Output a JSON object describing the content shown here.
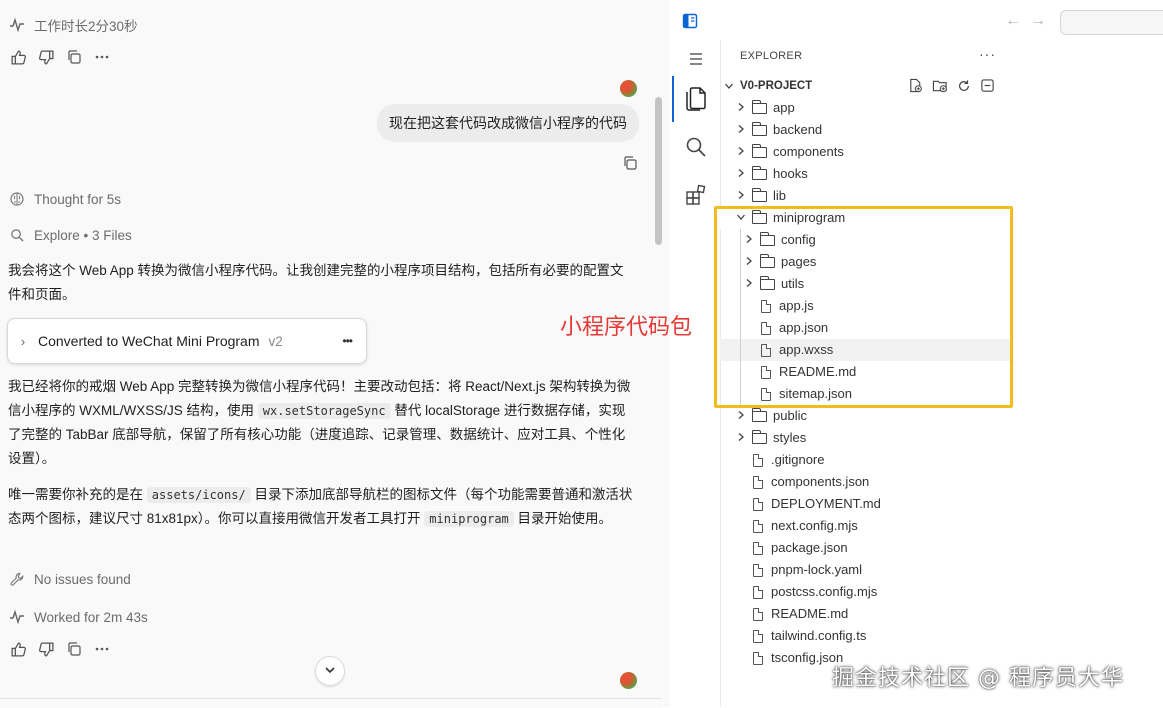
{
  "chat": {
    "work_duration": "工作时长2分30秒",
    "user_message": "现在把这套代码改成微信小程序的代码",
    "thought": "Thought for 5s",
    "explore": "Explore • 3 Files",
    "intro_text": "我会将这个 Web App 转换为微信小程序代码。让我创建完整的小程序项目结构，包括所有必要的配置文件和页面。",
    "card": {
      "title": "Converted to WeChat Mini Program",
      "version": "v2",
      "more": "•••"
    },
    "summary": {
      "p1_a": "我已经将你的戒烟 Web App 完整转换为微信小程序代码！主要改动包括：将 React/Next.js 架构转换为微信小程序的 WXML/WXSS/JS 结构，使用 ",
      "p1_code": "wx.setStorageSync",
      "p1_b": " 替代 localStorage 进行数据存储，实现了完整的 TabBar 底部导航，保留了所有核心功能（进度追踪、记录管理、数据统计、应对工具、个性化设置）。",
      "p2_a": "唯一需要你补充的是在 ",
      "p2_code1": "assets/icons/",
      "p2_b": " 目录下添加底部导航栏的图标文件（每个功能需要普通和激活状态两个图标，建议尺寸 81x81px）。你可以直接用微信开发者工具打开 ",
      "p2_code2": "miniprogram",
      "p2_c": " 目录开始使用。"
    },
    "no_issues": "No issues found",
    "worked_for": "Worked for 2m 43s"
  },
  "explorer": {
    "header": "EXPLORER",
    "more": "···",
    "project": "V0-PROJECT",
    "tree": [
      {
        "name": "app",
        "type": "folder",
        "depth": 0,
        "open": false
      },
      {
        "name": "backend",
        "type": "folder",
        "depth": 0,
        "open": false
      },
      {
        "name": "components",
        "type": "folder",
        "depth": 0,
        "open": false
      },
      {
        "name": "hooks",
        "type": "folder",
        "depth": 0,
        "open": false
      },
      {
        "name": "lib",
        "type": "folder",
        "depth": 0,
        "open": false
      },
      {
        "name": "miniprogram",
        "type": "folder",
        "depth": 0,
        "open": true
      },
      {
        "name": "config",
        "type": "folder",
        "depth": 1,
        "open": false
      },
      {
        "name": "pages",
        "type": "folder",
        "depth": 1,
        "open": false
      },
      {
        "name": "utils",
        "type": "folder",
        "depth": 1,
        "open": false
      },
      {
        "name": "app.js",
        "type": "file",
        "depth": 1
      },
      {
        "name": "app.json",
        "type": "file",
        "depth": 1
      },
      {
        "name": "app.wxss",
        "type": "file",
        "depth": 1
      },
      {
        "name": "README.md",
        "type": "file",
        "depth": 1
      },
      {
        "name": "sitemap.json",
        "type": "file",
        "depth": 1
      },
      {
        "name": "public",
        "type": "folder",
        "depth": 0,
        "open": false
      },
      {
        "name": "styles",
        "type": "folder",
        "depth": 0,
        "open": false
      },
      {
        "name": ".gitignore",
        "type": "file",
        "depth": 0
      },
      {
        "name": "components.json",
        "type": "file",
        "depth": 0
      },
      {
        "name": "DEPLOYMENT.md",
        "type": "file",
        "depth": 0
      },
      {
        "name": "next.config.mjs",
        "type": "file",
        "depth": 0
      },
      {
        "name": "package.json",
        "type": "file",
        "depth": 0
      },
      {
        "name": "pnpm-lock.yaml",
        "type": "file",
        "depth": 0
      },
      {
        "name": "postcss.config.mjs",
        "type": "file",
        "depth": 0
      },
      {
        "name": "README.md",
        "type": "file",
        "depth": 0
      },
      {
        "name": "tailwind.config.ts",
        "type": "file",
        "depth": 0
      },
      {
        "name": "tsconfig.json",
        "type": "file",
        "depth": 0
      }
    ]
  },
  "annotation": "小程序代码包",
  "watermark": "掘金技术社区 @ 程序员大华",
  "colors": {
    "highlight": "#f2bd1c",
    "annotation": "#e53935",
    "accent": "#0a64d6"
  }
}
